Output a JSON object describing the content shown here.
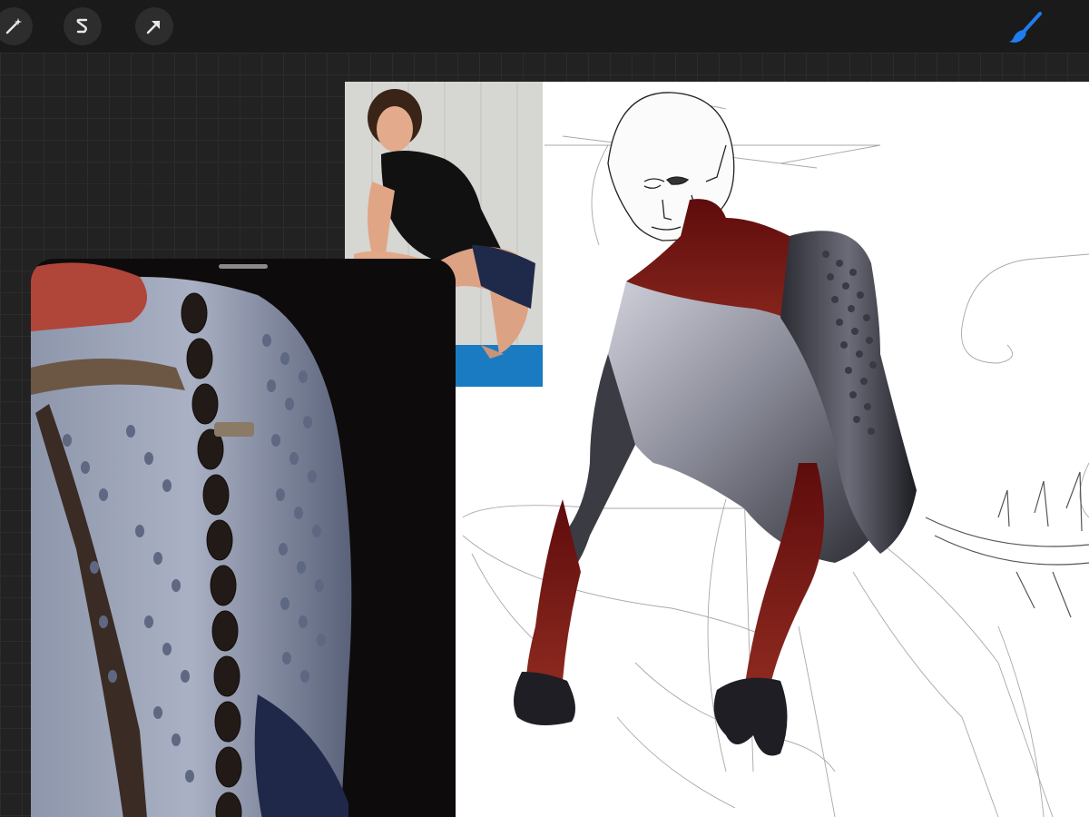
{
  "app": {
    "accent": "#1e7df0",
    "canvas_bg": "#ffffff",
    "workspace_bg": "#222222"
  },
  "toolbar": {
    "left_tools": [
      {
        "name": "adjustments",
        "icon": "magic-wand-icon"
      },
      {
        "name": "selection",
        "icon": "selection-s-icon"
      },
      {
        "name": "transform",
        "icon": "arrow-cursor-icon"
      }
    ],
    "right_tools": [
      {
        "name": "brush",
        "icon": "brush-icon",
        "active": true
      }
    ]
  },
  "reference": {
    "photo": {
      "icon": "photo-reference-image"
    },
    "panel": {
      "icon": "texture-reference-image"
    }
  },
  "artwork": {
    "icon": "creature-sketch-image",
    "colors": {
      "skin": "#5a5a66",
      "red": "#7a1414",
      "line": "#222222"
    }
  }
}
